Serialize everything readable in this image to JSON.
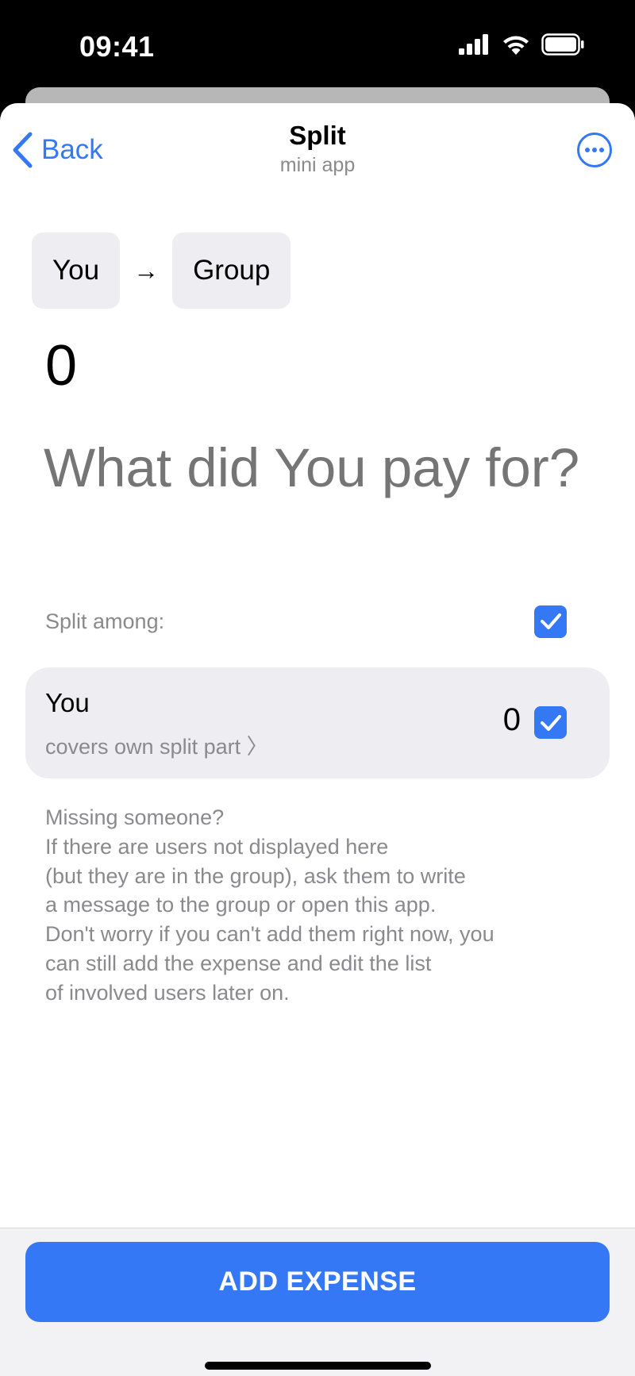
{
  "status_bar": {
    "time": "09:41",
    "icons": [
      "cellular-signal-icon",
      "wifi-icon",
      "battery-icon"
    ]
  },
  "nav": {
    "back_label": "Back",
    "title": "Split",
    "subtitle": "mini app",
    "more_icon": "ellipsis-circle-icon"
  },
  "route": {
    "from": "You",
    "arrow": "→",
    "to": "Group"
  },
  "amount": "0",
  "description": {
    "value": "",
    "placeholder": "What did You pay for?"
  },
  "split": {
    "label": "Split among:",
    "all_checked": true
  },
  "members": [
    {
      "name": "You",
      "subtitle": "covers own split part 〉",
      "amount": "0",
      "checked": true
    }
  ],
  "hint_lines": [
    "Missing someone?",
    "If there are users not displayed here",
    "(but they are in the group), ask them to write",
    "a message to the group or open this app.",
    "Don't worry if you can't add them right now, you",
    "can still add the expense and edit the list",
    "of involved users later on."
  ],
  "footer": {
    "button_label": "ADD EXPENSE"
  },
  "colors": {
    "accent": "#3478f6",
    "chip_bg": "#eeeef2",
    "secondary_text": "#8a8a8e",
    "placeholder_text": "#a8a8ab"
  }
}
